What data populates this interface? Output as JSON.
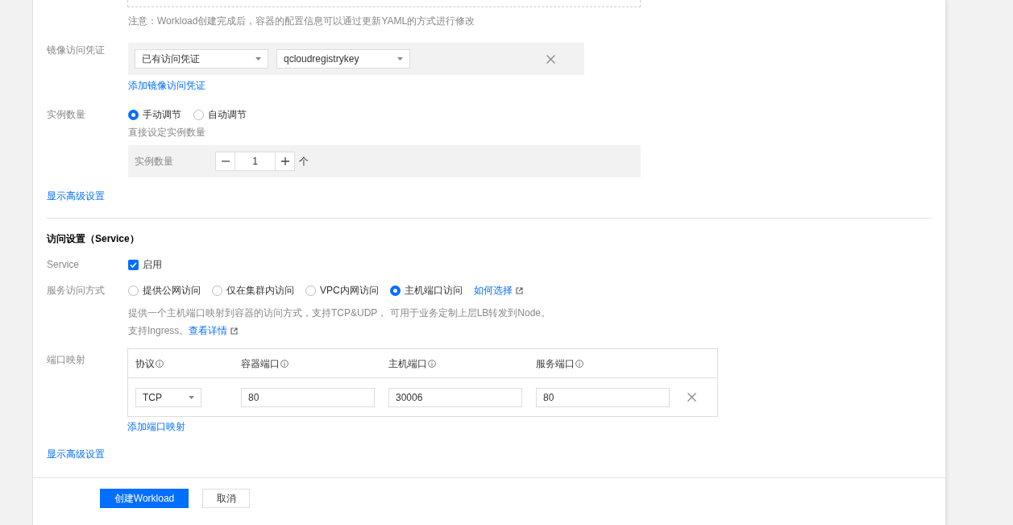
{
  "note": "注意：Workload创建完成后，容器的配置信息可以通过更新YAML的方式进行修改",
  "image_credential": {
    "label": "镜像访问凭证",
    "selects": [
      {
        "value": "已有访问凭证"
      },
      {
        "value": "qcloudregistrykey"
      }
    ],
    "add_link": "添加镜像访问凭证"
  },
  "instances": {
    "label": "实例数量",
    "options": [
      {
        "label": "手动调节",
        "selected": true
      },
      {
        "label": "自动调节",
        "selected": false
      }
    ],
    "hint": "直接设定实例数量",
    "count_label": "实例数量",
    "count": "1",
    "unit": "个",
    "advanced_link": "显示高级设置"
  },
  "service_section": {
    "heading": "访问设置（Service）",
    "service": {
      "label": "Service",
      "text": "启用",
      "checked": true
    },
    "access": {
      "label": "服务访问方式",
      "options": [
        {
          "label": "提供公网访问",
          "selected": false
        },
        {
          "label": "仅在集群内访问",
          "selected": false
        },
        {
          "label": "VPC内网访问",
          "selected": false
        },
        {
          "label": "主机端口访问",
          "selected": true
        }
      ],
      "help_link": "如何选择",
      "description": "提供一个主机端口映射到容器的访问方式，支持TCP&UDP， 可用于业务定制上层LB转发到Node。",
      "ingress_note": "支持Ingress。",
      "detail_link": "查看详情"
    },
    "ports": {
      "label": "端口映射",
      "columns": [
        "协议",
        "容器端口",
        "主机端口",
        "服务端口"
      ],
      "rows": [
        {
          "protocol": "TCP",
          "container_port": "80",
          "host_port": "30006",
          "service_port": "80"
        }
      ],
      "add_link": "添加端口映射"
    },
    "advanced_link": "显示高级设置"
  },
  "buttons": [
    {
      "label": "创建Workload",
      "kind": "primary"
    },
    {
      "label": "取消",
      "kind": "default"
    }
  ]
}
